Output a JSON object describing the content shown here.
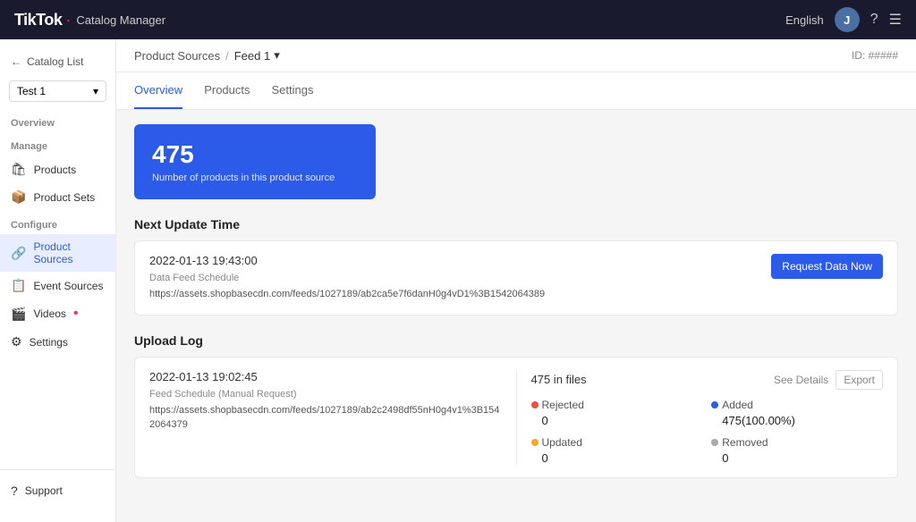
{
  "topnav": {
    "logo_text": "TikTok",
    "logo_dot": "·",
    "catalog_label": "Catalog Manager",
    "language": "English",
    "avatar_initial": "J",
    "help_icon": "?",
    "menu_icon": "☰"
  },
  "sidebar": {
    "back_label": "Catalog List",
    "selected_catalog": "Test 1",
    "sections": [
      {
        "label": "Overview",
        "items": []
      },
      {
        "label": "Manage",
        "items": [
          {
            "id": "products",
            "label": "Products",
            "icon": "🛍"
          },
          {
            "id": "product-sets",
            "label": "Product Sets",
            "icon": "📦"
          }
        ]
      },
      {
        "label": "Configure",
        "items": [
          {
            "id": "product-sources",
            "label": "Product Sources",
            "icon": "🔗",
            "active": true
          },
          {
            "id": "event-sources",
            "label": "Event Sources",
            "icon": "📋"
          },
          {
            "id": "videos",
            "label": "Videos",
            "icon": "🎬",
            "badge": "•"
          },
          {
            "id": "settings",
            "label": "Settings",
            "icon": "⚙"
          }
        ]
      }
    ],
    "bottom_items": [
      {
        "id": "support",
        "label": "Support",
        "icon": "?"
      }
    ]
  },
  "header": {
    "breadcrumb_parent": "Product Sources",
    "breadcrumb_separator": "/",
    "breadcrumb_current": "Feed 1",
    "id_label": "ID: #####"
  },
  "tabs": [
    {
      "id": "overview",
      "label": "Overview",
      "active": true
    },
    {
      "id": "products",
      "label": "Products",
      "active": false
    },
    {
      "id": "settings",
      "label": "Settings",
      "active": false
    }
  ],
  "stats_card": {
    "number": "475",
    "label": "Number of products in this product source"
  },
  "next_update": {
    "section_title": "Next Update Time",
    "time": "2022-01-13 19:43:00",
    "schedule_label": "Data Feed Schedule",
    "url": "https://assets.shopbasecdn.com/feeds/1027189/ab2ca5e7f6danH0g4vD1%3B1542064389",
    "request_btn_label": "Request Data Now"
  },
  "upload_log": {
    "section_title": "Upload Log",
    "time": "2022-01-13 19:02:45",
    "schedule_label": "Feed Schedule (Manual Request)",
    "url": "https://assets.shopbasecdn.com/feeds/1027189/ab2c2498df55nH0g4v1%3B1542064379",
    "files_label": "475 in files",
    "see_details_label": "See Details",
    "export_label": "Export",
    "stats": {
      "rejected": {
        "label": "Rejected",
        "value": "0",
        "dot": "red"
      },
      "added": {
        "label": "Added",
        "value": "475(100.00%)",
        "dot": "blue"
      },
      "updated": {
        "label": "Updated",
        "value": "0",
        "dot": "orange"
      },
      "removed": {
        "label": "Removed",
        "value": "0",
        "dot": "gray"
      }
    }
  }
}
